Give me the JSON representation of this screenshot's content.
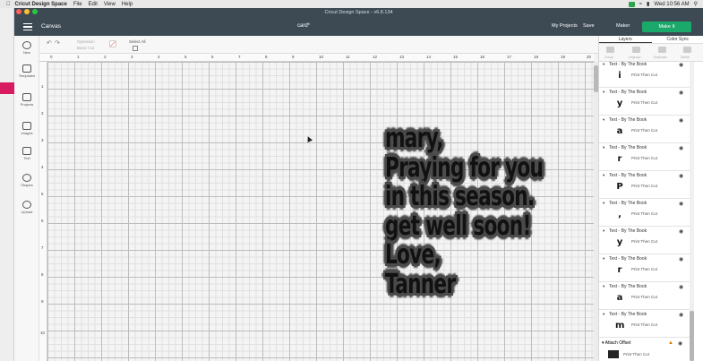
{
  "mac_menubar": {
    "app": "Cricut Design Space",
    "menus": [
      "File",
      "Edit",
      "View",
      "Help"
    ],
    "clock": "Wed 10:56 AM"
  },
  "window_title": "Cricut Design Space - v6.8.134",
  "header": {
    "section": "Canvas",
    "project_name": "card*",
    "my_projects": "My Projects",
    "save": "Save",
    "machine": "Maker",
    "make_button": "Make It"
  },
  "toolbar": {
    "operation": "Operation",
    "operation_value": "Basic Cut",
    "select_all": "Select All"
  },
  "rail": {
    "items": [
      "New",
      "Templates",
      "Projects",
      "Images",
      "Text",
      "Shapes",
      "Upload"
    ]
  },
  "ruler_top": [
    "0",
    "1",
    "2",
    "3",
    "4",
    "5",
    "6",
    "7",
    "8",
    "9",
    "10",
    "11",
    "12",
    "13",
    "14",
    "15",
    "16",
    "17",
    "18",
    "19",
    "20"
  ],
  "ruler_left": [
    "1",
    "2",
    "3",
    "4",
    "5",
    "6",
    "7",
    "8",
    "9",
    "10"
  ],
  "canvas_text": {
    "lines": [
      "mary,",
      "Praying for you",
      "in this season.",
      "get well soon!",
      "Love,",
      "Tanner"
    ]
  },
  "panel": {
    "tabs": [
      "Layers",
      "Color Sync"
    ],
    "tools": [
      "Group",
      "Ungroup",
      "Duplicate",
      "Delete"
    ],
    "layers": [
      {
        "name": "Text - By The Book",
        "op": "Print Then Cut",
        "glyph": "i"
      },
      {
        "name": "Text - By The Book",
        "op": "Print Then Cut",
        "glyph": "y"
      },
      {
        "name": "Text - By The Book",
        "op": "Print Then Cut",
        "glyph": "a"
      },
      {
        "name": "Text - By The Book",
        "op": "Print Then Cut",
        "glyph": "r"
      },
      {
        "name": "Text - By The Book",
        "op": "Print Then Cut",
        "glyph": "P"
      },
      {
        "name": "Text - By The Book",
        "op": "Print Then Cut",
        "glyph": ","
      },
      {
        "name": "Text - By The Book",
        "op": "Print Then Cut",
        "glyph": "y"
      },
      {
        "name": "Text - By The Book",
        "op": "Print Then Cut",
        "glyph": "r"
      },
      {
        "name": "Text - By The Book",
        "op": "Print Then Cut",
        "glyph": "a"
      },
      {
        "name": "Text - By The Book",
        "op": "Print Then Cut",
        "glyph": "m"
      }
    ],
    "attach": {
      "name": "Attach Offset",
      "op": "Print Then Cut"
    }
  },
  "colors": {
    "header": "#3d4a54",
    "make_button": "#1aa96b",
    "sticker_outline": "#4d4d4d",
    "browser_tab_accent": "#d81b60"
  }
}
